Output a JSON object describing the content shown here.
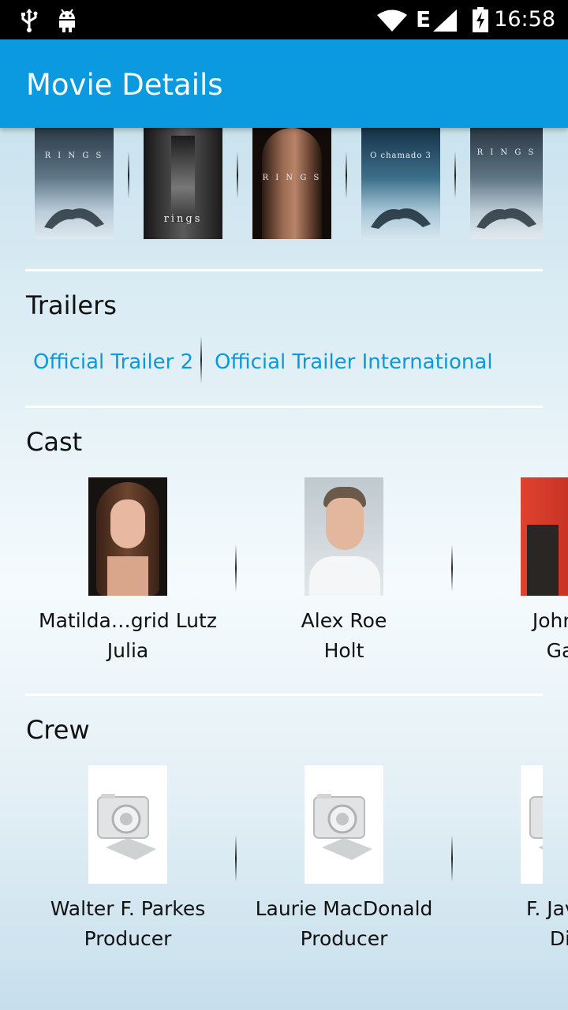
{
  "status_bar": {
    "time": "16:58",
    "network_label": "E",
    "icons": [
      "usb-icon",
      "android-icon",
      "wifi-icon",
      "cell-signal-icon",
      "battery-charging-icon"
    ]
  },
  "app_bar": {
    "title": "Movie Details"
  },
  "posters": [
    {
      "text": "R I N G S"
    },
    {
      "text": "rings"
    },
    {
      "text": "R I N G S"
    },
    {
      "text": "O chamado 3"
    },
    {
      "text": "R I N G S"
    }
  ],
  "trailers": {
    "heading": "Trailers",
    "items": [
      {
        "label": "Official Trailer 2"
      },
      {
        "label": "Official Trailer International"
      }
    ]
  },
  "cast": {
    "heading": "Cast",
    "items": [
      {
        "name": "Matilda…grid Lutz",
        "role": "Julia"
      },
      {
        "name": "Alex Roe",
        "role": "Holt"
      },
      {
        "name": "Johnn",
        "role": "Ga"
      }
    ]
  },
  "crew": {
    "heading": "Crew",
    "items": [
      {
        "name": "Walter F. Parkes",
        "role": "Producer"
      },
      {
        "name": "Laurie MacDonald",
        "role": "Producer"
      },
      {
        "name": "F. Javie",
        "role": "Di"
      }
    ]
  },
  "colors": {
    "app_bar": "#0b9ae0",
    "link": "#0b9ad8",
    "status_bar": "#000000"
  }
}
